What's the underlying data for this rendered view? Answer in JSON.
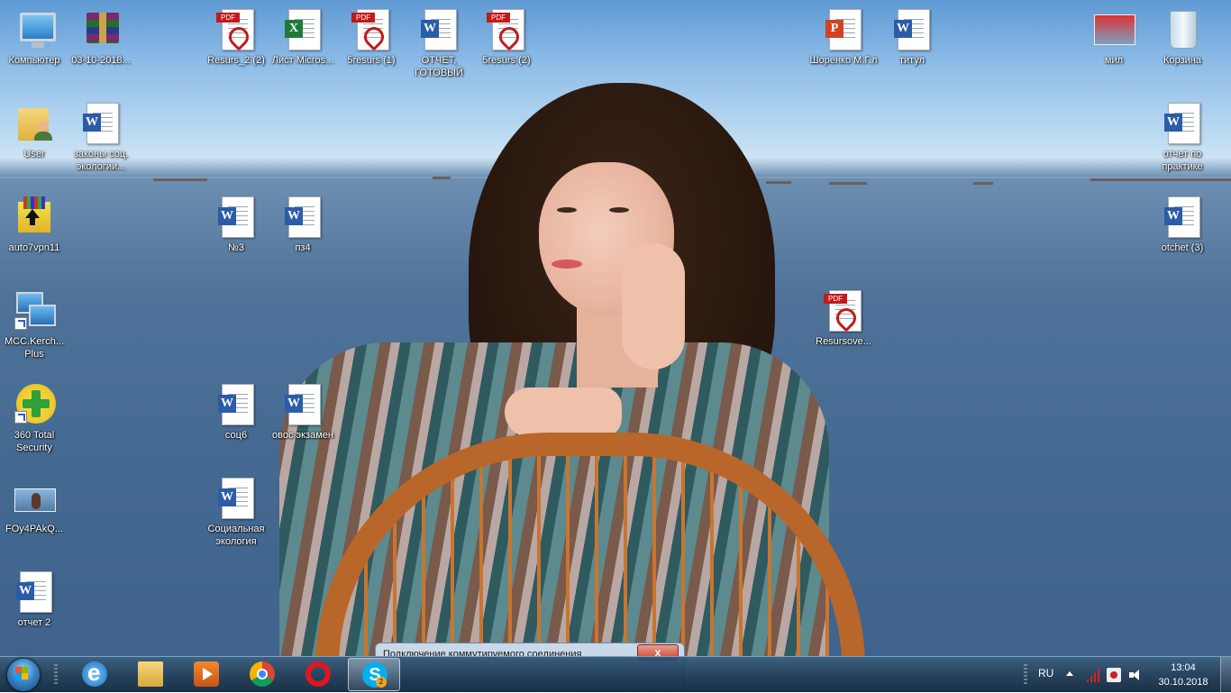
{
  "desktop": {
    "icons": [
      {
        "label": "Компьютер",
        "icon": "computer-icon"
      },
      {
        "label": "03-10-2018...",
        "icon": "winrar-archive-icon"
      },
      {
        "label": "Resurs_2 (2)",
        "icon": "pdf-icon"
      },
      {
        "label": "Лист Micros...",
        "icon": "excel-icon"
      },
      {
        "label": "5resurs (1)",
        "icon": "pdf-icon"
      },
      {
        "label": "ОТЧЕТ, ГОТОВЫЙ",
        "icon": "word-icon"
      },
      {
        "label": "5resurs (2)",
        "icon": "pdf-icon"
      },
      {
        "label": "Шоренко М.Г.л",
        "icon": "powerpoint-icon"
      },
      {
        "label": "титул",
        "icon": "word-icon"
      },
      {
        "label": "мил",
        "icon": "powerpoint-thumbnail-icon"
      },
      {
        "label": "Корзина",
        "icon": "recycle-bin-icon"
      },
      {
        "label": "User",
        "icon": "user-folder-icon"
      },
      {
        "label": "законы соц. экологии...",
        "icon": "word-icon"
      },
      {
        "label": "отчет по практике",
        "icon": "word-icon"
      },
      {
        "label": "auto7vpn11",
        "icon": "winrar-sfx-icon"
      },
      {
        "label": "№3",
        "icon": "word-icon"
      },
      {
        "label": "пз4",
        "icon": "word-icon"
      },
      {
        "label": "otchet (3)",
        "icon": "word-icon"
      },
      {
        "label": "MCC.Kerch... Plus",
        "icon": "network-shortcut-icon"
      },
      {
        "label": "Resursove...",
        "icon": "pdf-icon"
      },
      {
        "label": "360 Total Security",
        "icon": "security-shortcut-icon"
      },
      {
        "label": "соц6",
        "icon": "word-icon"
      },
      {
        "label": "овос экзамен",
        "icon": "word-icon"
      },
      {
        "label": "FOy4PAkQ...",
        "icon": "image-thumbnail-icon"
      },
      {
        "label": "Социальная экология",
        "icon": "word-icon"
      },
      {
        "label": "отчет 2",
        "icon": "word-icon"
      }
    ]
  },
  "dialog": {
    "title": "Подключение коммутируемого соединения",
    "close": "x"
  },
  "taskbar": {
    "skype_badge": "2",
    "language": "RU",
    "time": "13:04",
    "date": "30.10.2018"
  },
  "colors": {
    "taskbar": "#1c3a56",
    "word": "#2b5ca8",
    "excel": "#1f7a3a",
    "powerpoint": "#d04423",
    "pdf": "#c21a1a"
  }
}
